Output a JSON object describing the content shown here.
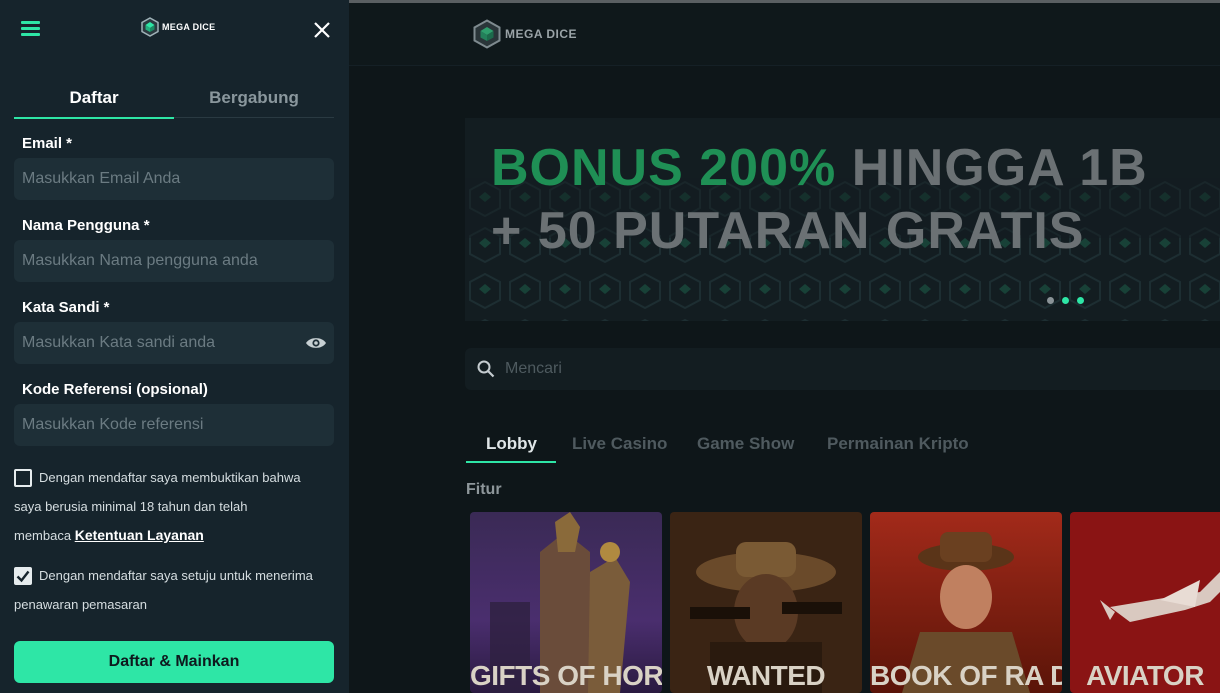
{
  "drawer": {
    "logo_text": "MEGA DICE",
    "tabs": [
      {
        "label": "Daftar",
        "active": true
      },
      {
        "label": "Bergabung",
        "active": false
      }
    ],
    "fields": {
      "email": {
        "label": "Email *",
        "placeholder": "Masukkan Email Anda"
      },
      "username": {
        "label": "Nama Pengguna *",
        "placeholder": "Masukkan Nama pengguna anda"
      },
      "password": {
        "label": "Kata Sandi *",
        "placeholder": "Masukkan Kata sandi anda"
      },
      "referral": {
        "label": "Kode Referensi (opsional)",
        "placeholder": "Masukkan Kode referensi"
      }
    },
    "terms": {
      "checked": false,
      "line1": "Dengan mendaftar saya membuktikan bahwa",
      "line2": "saya berusia minimal 18 tahun dan telah",
      "line3_prefix": "membaca",
      "link": "Ketentuan Layanan"
    },
    "marketing": {
      "checked": true,
      "line1": "Dengan mendaftar saya setuju untuk menerima",
      "line2": "penawaran pemasaran"
    },
    "submit_label": "Daftar & Mainkan"
  },
  "header": {
    "logo_text": "MEGA DICE"
  },
  "banner": {
    "highlight": "BONUS 200%",
    "line1_rest": "HINGGA 1B",
    "line2": "+ 50 PUTARAN GRATIS",
    "slides": 3,
    "active_slide": 0
  },
  "search": {
    "placeholder": "Mencari"
  },
  "categories": [
    {
      "label": "Lobby",
      "active": true
    },
    {
      "label": "Live Casino",
      "active": false
    },
    {
      "label": "Game Show",
      "active": false
    },
    {
      "label": "Permainan Kripto",
      "active": false
    }
  ],
  "section_title": "Fitur",
  "games": [
    {
      "title": "GIFTS OF HORUS"
    },
    {
      "title": "WANTED"
    },
    {
      "title": "BOOK OF RA DELUXE"
    },
    {
      "title": "AVIATOR"
    }
  ],
  "colors": {
    "accent": "#2ee6a6",
    "panel": "#16242c",
    "background": "#0e1619",
    "banner_green": "#1f8f55"
  }
}
